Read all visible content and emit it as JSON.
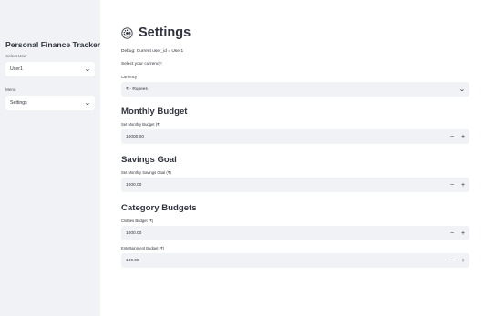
{
  "sidebar": {
    "app_title": "Personal Finance Tracker",
    "user_label": "Select User",
    "user_value": "User1",
    "menu_label": "Menu",
    "menu_value": "Settings"
  },
  "main": {
    "title": "Settings",
    "debug": "Debug: Current user_id = User1",
    "currency_prompt": "Select your currency:",
    "currency_label": "Currency",
    "currency_value": "₹ - Rupees",
    "monthly_budget": {
      "heading": "Monthly Budget",
      "label": "Set Monthly Budget (₹)",
      "value": "10000.00"
    },
    "savings_goal": {
      "heading": "Savings Goal",
      "label": "Set Monthly Savings Goal (₹)",
      "value": "1000.00"
    },
    "category_budgets": {
      "heading": "Category Budgets",
      "clothes_label": "Clothes Budget (₹)",
      "clothes_value": "1000.00",
      "entertainment_label": "Entertainment Budget (₹)",
      "entertainment_value": "100.00"
    }
  },
  "stepper": {
    "minus": "−",
    "plus": "+"
  },
  "icons": {
    "gear": "gear-icon",
    "chevron": "chevron-down-icon"
  }
}
